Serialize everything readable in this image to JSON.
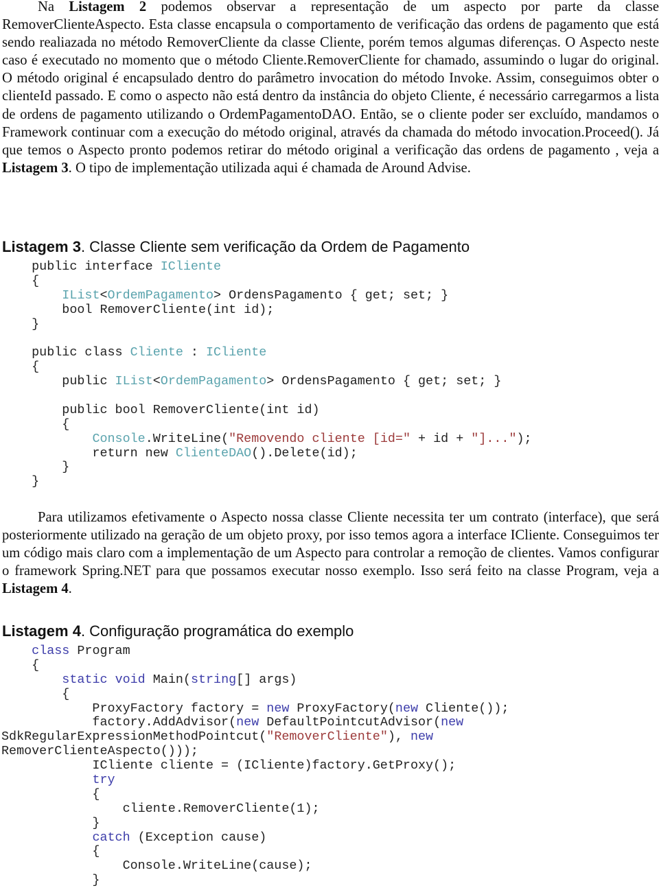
{
  "paragraph1": {
    "intro": "Na ",
    "ref1": "Listagem 2",
    "text1": " podemos observar a representação de um aspecto por parte da classe RemoverClienteAspecto. Esta classe encapsula o comportamento de verificação das ordens de pagamento que está sendo realiazada no método RemoverCliente da classe Cliente, porém temos algumas diferenças. O Aspecto neste caso é executado no momento que o método Cliente.RemoverCliente for chamado, assumindo o lugar do original. O método original é encapsulado dentro do parâmetro invocation  do  método Invoke. Assim, conseguimos obter o clienteId passado. E como o aspecto não está dentro da instância do objeto Cliente, é necessário carregarmos a lista de ordens de pagamento utilizando o OrdemPagamentoDAO. Então, se o cliente poder ser excluído, mandamos o Framework continuar com a execução do método original, através da chamada do método invocation.Proceed(). Já que temos o Aspecto pronto podemos retirar do método original a verificação das ordens de pagamento , veja a ",
    "ref2": "Listagem 3",
    "text2": ". O tipo de implementação utilizada aqui é chamada de Around Advise."
  },
  "listing3": {
    "caption_label": "Listagem 3",
    "caption_text": ". Classe Cliente sem verificação da Ordem de Pagamento",
    "lines": [
      [
        {
          "c": "    public interface "
        },
        {
          "c": "ICliente",
          "s": "t"
        }
      ],
      [
        {
          "c": "    {"
        }
      ],
      [
        {
          "c": "        "
        },
        {
          "c": "IList",
          "s": "t"
        },
        {
          "c": "<"
        },
        {
          "c": "OrdemPagamento",
          "s": "t"
        },
        {
          "c": "> OrdensPagamento { get; set; }"
        }
      ],
      [
        {
          "c": "        bool RemoverCliente(int id);"
        }
      ],
      [
        {
          "c": "    }"
        }
      ],
      [
        {
          "c": ""
        }
      ],
      [
        {
          "c": "    public class "
        },
        {
          "c": "Cliente",
          "s": "t"
        },
        {
          "c": " : "
        },
        {
          "c": "ICliente",
          "s": "t"
        }
      ],
      [
        {
          "c": "    {"
        }
      ],
      [
        {
          "c": "        public "
        },
        {
          "c": "IList",
          "s": "t"
        },
        {
          "c": "<"
        },
        {
          "c": "OrdemPagamento",
          "s": "t"
        },
        {
          "c": "> OrdensPagamento { get; set; }"
        }
      ],
      [
        {
          "c": ""
        }
      ],
      [
        {
          "c": "        public bool RemoverCliente(int id)"
        }
      ],
      [
        {
          "c": "        {"
        }
      ],
      [
        {
          "c": "            "
        },
        {
          "c": "Console",
          "s": "t"
        },
        {
          "c": ".WriteLine("
        },
        {
          "c": "\"Removendo cliente [id=\"",
          "s": "s"
        },
        {
          "c": " + id + "
        },
        {
          "c": "\"]...\"",
          "s": "s"
        },
        {
          "c": ");"
        }
      ],
      [
        {
          "c": "            return new "
        },
        {
          "c": "ClienteDAO",
          "s": "t"
        },
        {
          "c": "().Delete(id);"
        }
      ],
      [
        {
          "c": "        }"
        }
      ],
      [
        {
          "c": "    }"
        }
      ]
    ]
  },
  "paragraph2": {
    "text1": "Para utilizamos efetivamente o Aspecto nossa classe Cliente necessita ter um contrato (interface), que será posteriormente utilizado na geração de um objeto proxy, por isso temos agora a interface ICliente. Conseguimos ter um código mais claro com a implementação de um Aspecto para controlar a remoção de clientes. Vamos configurar o framework Spring.NET para que possamos executar nosso exemplo. Isso será feito na classe Program, veja a ",
    "ref": "Listagem 4",
    "text2": "."
  },
  "listing4": {
    "caption_label": "Listagem 4",
    "caption_text": ". Configuração programática do exemplo",
    "lines": [
      [
        {
          "c": "    "
        },
        {
          "c": "class",
          "s": "k"
        },
        {
          "c": " Program"
        }
      ],
      [
        {
          "c": "    {"
        }
      ],
      [
        {
          "c": "        "
        },
        {
          "c": "static",
          "s": "k"
        },
        {
          "c": " "
        },
        {
          "c": "void",
          "s": "k"
        },
        {
          "c": " Main("
        },
        {
          "c": "string",
          "s": "k"
        },
        {
          "c": "[] args)"
        }
      ],
      [
        {
          "c": "        {"
        }
      ],
      [
        {
          "c": "            ProxyFactory factory = "
        },
        {
          "c": "new",
          "s": "k"
        },
        {
          "c": " ProxyFactory("
        },
        {
          "c": "new",
          "s": "k"
        },
        {
          "c": " Cliente());"
        }
      ],
      [
        {
          "c": "            factory.AddAdvisor("
        },
        {
          "c": "new",
          "s": "k"
        },
        {
          "c": " DefaultPointcutAdvisor("
        },
        {
          "c": "new",
          "s": "k"
        }
      ],
      [
        {
          "c": "SdkRegularExpressionMethodPointcut("
        },
        {
          "c": "\"RemoverCliente\"",
          "s": "s"
        },
        {
          "c": "), "
        },
        {
          "c": "new",
          "s": "k"
        }
      ],
      [
        {
          "c": "RemoverClienteAspecto()));"
        }
      ],
      [
        {
          "c": "            ICliente cliente = (ICliente)factory.GetProxy();"
        }
      ],
      [
        {
          "c": "            "
        },
        {
          "c": "try",
          "s": "k"
        }
      ],
      [
        {
          "c": "            {"
        }
      ],
      [
        {
          "c": "                cliente.RemoverCliente(1);"
        }
      ],
      [
        {
          "c": "            }"
        }
      ],
      [
        {
          "c": "            "
        },
        {
          "c": "catch",
          "s": "k"
        },
        {
          "c": " (Exception cause)"
        }
      ],
      [
        {
          "c": "            {"
        }
      ],
      [
        {
          "c": "                Console.WriteLine(cause);"
        }
      ],
      [
        {
          "c": "            }"
        }
      ]
    ]
  }
}
